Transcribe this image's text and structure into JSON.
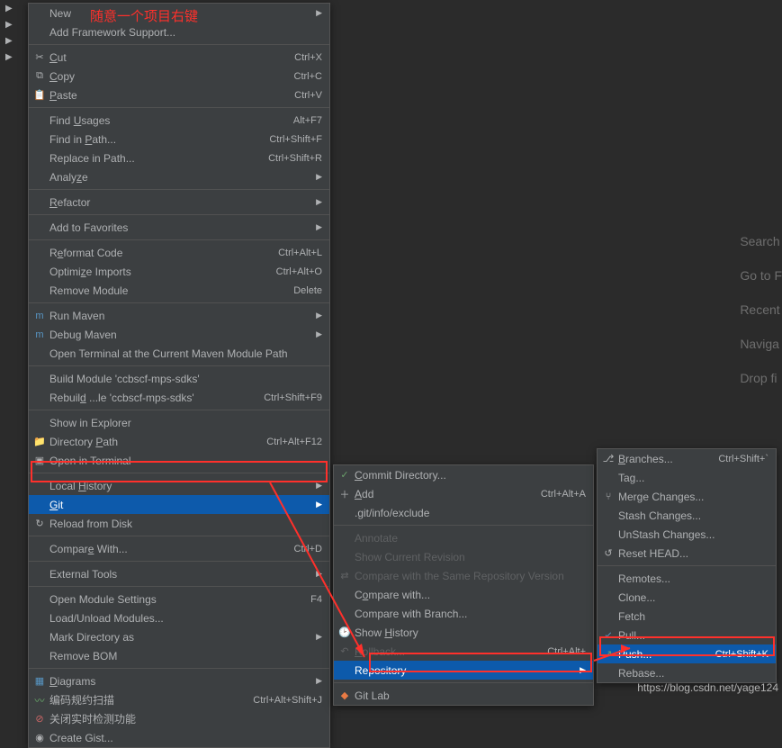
{
  "annotation": "随意一个项目右键",
  "watermark": "https://blog.csdn.net/yage124",
  "bg_hints": {
    "search": "Search",
    "goto": "Go to F",
    "recent": "Recent",
    "navigate": "Naviga",
    "drop": "Drop fi"
  },
  "menu1": {
    "new": {
      "label": "New",
      "arrow": "▶"
    },
    "framework": {
      "label": "Add Framework Support..."
    },
    "cut": {
      "label": "Cut",
      "shortcut": "Ctrl+X",
      "underline": true
    },
    "copy": {
      "label": "Copy",
      "shortcut": "Ctrl+C",
      "underline": "C"
    },
    "paste": {
      "label": "Paste",
      "shortcut": "Ctrl+V",
      "underline": "P"
    },
    "find_usages": {
      "label": "Find Usages",
      "shortcut": "Alt+F7",
      "underline": "U"
    },
    "find_in_path": {
      "label": "Find in Path...",
      "shortcut": "Ctrl+Shift+F"
    },
    "replace_in_path": {
      "label": "Replace in Path...",
      "shortcut": "Ctrl+Shift+R"
    },
    "analyze": {
      "label": "Analyze",
      "arrow": "▶",
      "underline": "z"
    },
    "refactor": {
      "label": "Refactor",
      "arrow": "▶",
      "underline": "R"
    },
    "favorites": {
      "label": "Add to Favorites",
      "arrow": "▶"
    },
    "reformat": {
      "label": "Reformat Code",
      "shortcut": "Ctrl+Alt+L"
    },
    "optimize": {
      "label": "Optimize Imports",
      "shortcut": "Ctrl+Alt+O"
    },
    "remove_module": {
      "label": "Remove Module",
      "shortcut": "Delete"
    },
    "run_maven": {
      "label": "Run Maven",
      "arrow": "▶"
    },
    "debug_maven": {
      "label": "Debug Maven",
      "arrow": "▶"
    },
    "open_terminal_maven": {
      "label": "Open Terminal at the Current Maven Module Path"
    },
    "build_module": {
      "label": "Build Module 'ccbscf-mps-sdks'"
    },
    "rebuild": {
      "label": "Rebuild ...le 'ccbscf-mps-sdks'",
      "shortcut": "Ctrl+Shift+F9"
    },
    "show_explorer": {
      "label": "Show in Explorer"
    },
    "directory_path": {
      "label": "Directory Path",
      "shortcut": "Ctrl+Alt+F12"
    },
    "open_terminal": {
      "label": "Open in Terminal"
    },
    "local_history": {
      "label": "Local History",
      "arrow": "▶",
      "underline": "H"
    },
    "git": {
      "label": "Git",
      "arrow": "▶",
      "underline": "G"
    },
    "reload_disk": {
      "label": "Reload from Disk"
    },
    "compare": {
      "label": "Compare With...",
      "shortcut": "Ctrl+D"
    },
    "external_tools": {
      "label": "External Tools",
      "arrow": "▶"
    },
    "module_settings": {
      "label": "Open Module Settings",
      "shortcut": "F4"
    },
    "load_unload": {
      "label": "Load/Unload Modules..."
    },
    "mark_dir": {
      "label": "Mark Directory as",
      "arrow": "▶"
    },
    "remove_bom": {
      "label": "Remove BOM"
    },
    "diagrams": {
      "label": "Diagrams",
      "arrow": "▶",
      "underline": "D"
    },
    "encoding_scan": {
      "label": "编码规约扫描",
      "shortcut": "Ctrl+Alt+Shift+J"
    },
    "close_realtime": {
      "label": "关闭实时检测功能"
    },
    "create_gist": {
      "label": "Create Gist..."
    }
  },
  "menu2": {
    "commit": {
      "label": "Commit Directory...",
      "underline": "C"
    },
    "add": {
      "label": "Add",
      "shortcut": "Ctrl+Alt+A",
      "underline": "A"
    },
    "exclude": {
      "label": ".git/info/exclude"
    },
    "annotate": {
      "label": "Annotate"
    },
    "show_current": {
      "label": "Show Current Revision"
    },
    "compare_same": {
      "label": "Compare with the Same Repository Version"
    },
    "compare_with": {
      "label": "Compare with...",
      "underline": "o"
    },
    "compare_branch": {
      "label": "Compare with Branch..."
    },
    "show_history": {
      "label": "Show History",
      "underline": "H"
    },
    "rollback": {
      "label": "Rollback...",
      "shortcut": "Ctrl+Alt+"
    },
    "repository": {
      "label": "Repository",
      "arrow": "▶"
    },
    "gitlab": {
      "label": "Git Lab"
    }
  },
  "menu3": {
    "branches": {
      "label": "Branches...",
      "shortcut": "Ctrl+Shift+`",
      "underline": "B"
    },
    "tag": {
      "label": "Tag..."
    },
    "merge": {
      "label": "Merge Changes..."
    },
    "stash": {
      "label": "Stash Changes..."
    },
    "unstash": {
      "label": "UnStash Changes..."
    },
    "reset": {
      "label": "Reset HEAD..."
    },
    "remotes": {
      "label": "Remotes..."
    },
    "clone": {
      "label": "Clone..."
    },
    "fetch": {
      "label": "Fetch"
    },
    "pull": {
      "label": "Pull..."
    },
    "push": {
      "label": "Push...",
      "shortcut": "Ctrl+Shift+K"
    },
    "rebase": {
      "label": "Rebase..."
    }
  }
}
